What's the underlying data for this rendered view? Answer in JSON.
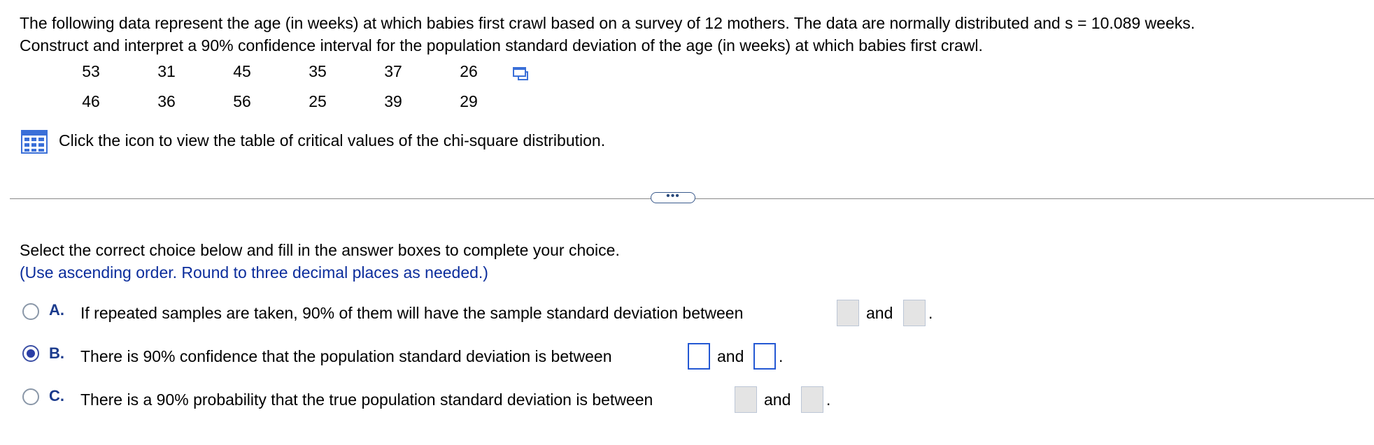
{
  "problem": {
    "line1": "The following data represent the age (in weeks) at which babies first crawl based on a survey of 12 mothers. The data are normally distributed and s = 10.089 weeks.",
    "line2": "Construct and interpret a 90% confidence interval for the population standard deviation of the age (in weeks) at which babies first crawl."
  },
  "data_rows": [
    [
      "53",
      "31",
      "45",
      "35",
      "37",
      "26"
    ],
    [
      "46",
      "36",
      "56",
      "25",
      "39",
      "29"
    ]
  ],
  "table_hint": "Click the icon to view the table of critical values of the chi-square distribution.",
  "more_label": "•••",
  "instruction": "Select the correct choice below and fill in the answer boxes to complete your choice.",
  "hint": "(Use ascending order. Round to three decimal places as needed.)",
  "choices": [
    {
      "letter": "A.",
      "text": "If repeated samples are taken, 90% of them will have the sample standard deviation between",
      "and": "and",
      "selected": false
    },
    {
      "letter": "B.",
      "text": "There is 90% confidence that the population standard deviation is between",
      "and": "and",
      "selected": true
    },
    {
      "letter": "C.",
      "text": "There is a 90% probability that the true population standard deviation is between",
      "and": "and",
      "selected": false
    }
  ],
  "period": ".",
  "colors": {
    "accent": "#2458d3",
    "hint_text": "#0b2d9c",
    "table_icon": "#3a6fd8"
  },
  "icons": {
    "copy": "copy-data-icon",
    "table": "table-grid-icon"
  }
}
